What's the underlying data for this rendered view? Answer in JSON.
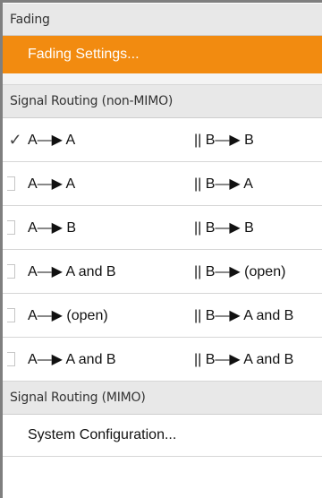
{
  "fading": {
    "header": "Fading",
    "settings_button": "Fading Settings..."
  },
  "routing_non_mimo": {
    "header": "Signal Routing (non-MIMO)",
    "rows": [
      {
        "checked": true,
        "left": "A—▶ A",
        "right": "|| B—▶ B"
      },
      {
        "checked": false,
        "left": "A—▶ A",
        "right": "|| B—▶ A"
      },
      {
        "checked": false,
        "left": "A—▶ B",
        "right": "|| B—▶ B"
      },
      {
        "checked": false,
        "left": "A—▶ A and B",
        "right": "|| B—▶ (open)"
      },
      {
        "checked": false,
        "left": "A—▶ (open)",
        "right": "|| B—▶ A and B"
      },
      {
        "checked": false,
        "left": "A—▶ A and B",
        "right": "|| B—▶ A and B"
      }
    ]
  },
  "routing_mimo": {
    "header": "Signal Routing (MIMO)",
    "system_button": "System Configuration..."
  },
  "colors": {
    "accent": "#f28b10",
    "header_bg": "#e8e8e8"
  },
  "icons": {
    "checked": "✓"
  }
}
